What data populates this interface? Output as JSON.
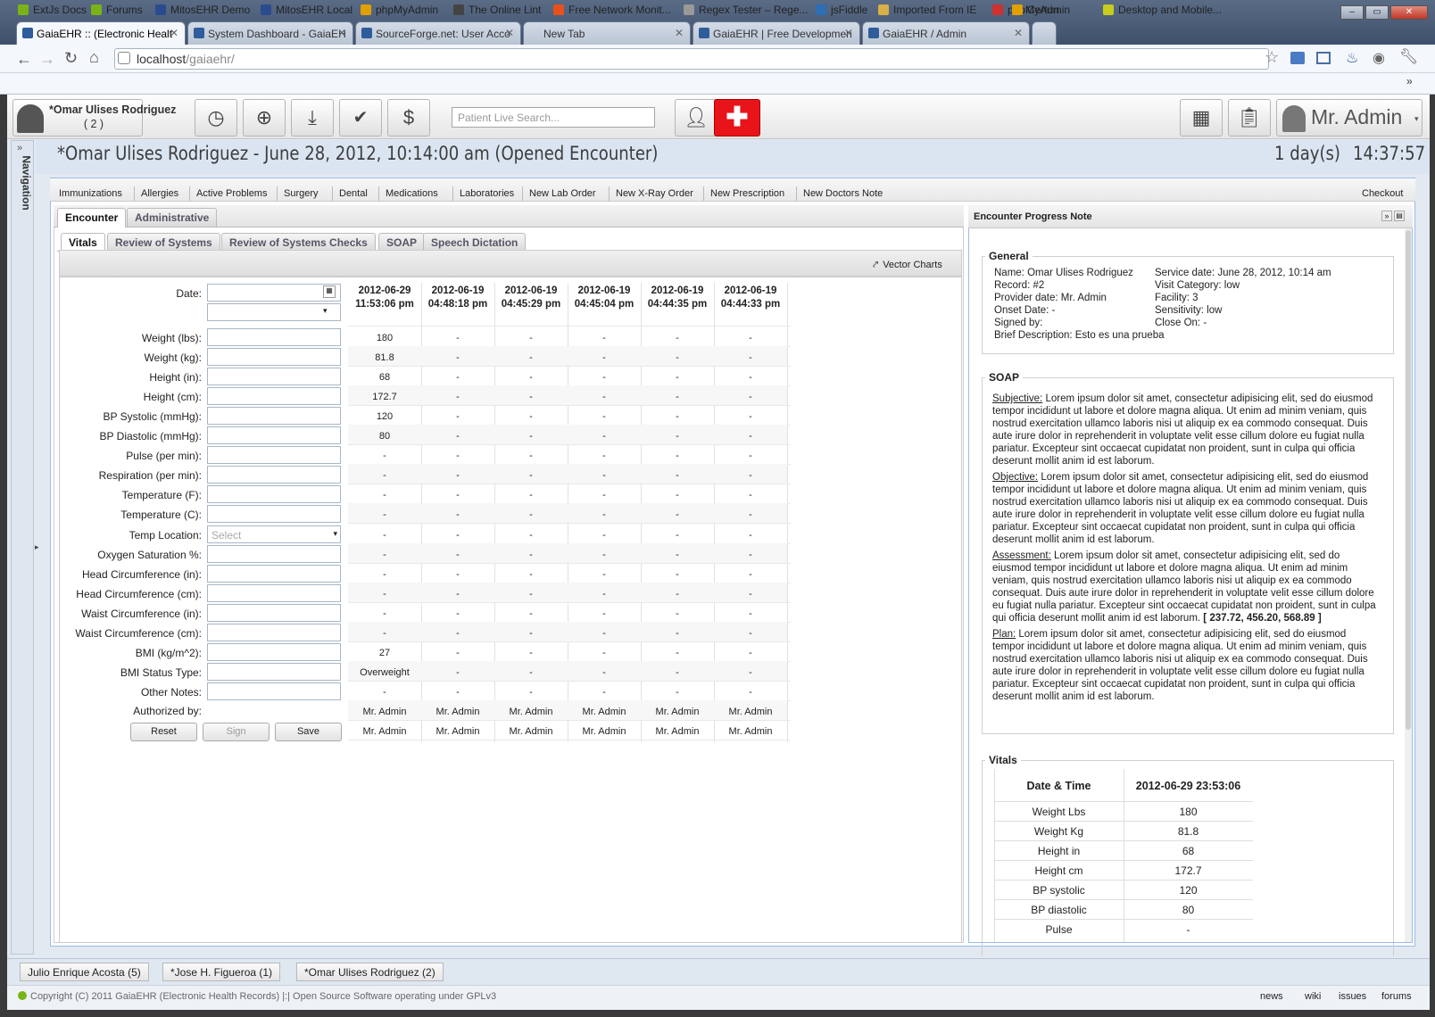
{
  "browser": {
    "tabs": [
      "GaiaEHR :: (Electronic Healt",
      "System Dashboard - GaiaEH",
      "SourceForge.net: User Acco",
      "New Tab",
      "GaiaEHR | Free Developmen",
      "GaiaEHR / Admin"
    ],
    "url_host": "localhost",
    "url_path": "/gaiaehr/",
    "bookmarks": [
      "ExtJs Docs",
      "Forums",
      "MitosEHR Demo",
      "MitosEHR Local",
      "phpMyAdmin",
      "The Online Lint",
      "Free Network Monit...",
      "Regex Tester – Rege...",
      "jsFiddle",
      "Imported From IE",
      "phpMyAdmin",
      "Certun",
      "Desktop and Mobile..."
    ],
    "bookmark_colors": [
      "#7ab317",
      "#7ab317",
      "#2a4c8f",
      "#2a4c8f",
      "#e0a000",
      "#444444",
      "#e8501e",
      "#999999",
      "#2f6db5",
      "#d7b048",
      "#d03030",
      "#e0a000",
      "#c7cc1f",
      "#7ab317"
    ]
  },
  "app": {
    "patient_name": "*Omar Ulises Rodriguez",
    "patient_record": "( 2 )",
    "search_placeholder": "Patient Live Search...",
    "user": "Mr. Admin",
    "navigation_label": "Navigation",
    "encounter_title": "*Omar Ulises Rodriguez - June 28, 2012, 10:14:00 am (Opened Encounter)",
    "elapsed_days": "1 day(s)",
    "elapsed_time": "14:37:57",
    "accent_red": "#e8141a"
  },
  "shortcuts": [
    "Immunizations",
    "Allergies",
    "Active Problems",
    "Surgery",
    "Dental",
    "Medications",
    "Laboratories",
    "New Lab Order",
    "New X-Ray Order",
    "New Prescription",
    "New Doctors Note"
  ],
  "checkout": "Checkout",
  "encounter_tabs": [
    "Encounter",
    "Administrative"
  ],
  "vitals_tabs": [
    "Vitals",
    "Review of Systems",
    "Review of Systems Checks",
    "SOAP",
    "Speech Dictation"
  ],
  "vector_charts": "Vector Charts",
  "form": {
    "date_label": "Date:",
    "labels": [
      "Weight (lbs):",
      "Weight (kg):",
      "Height (in):",
      "Height (cm):",
      "BP Systolic (mmHg):",
      "BP Diastolic (mmHg):",
      "Pulse (per min):",
      "Respiration (per min):",
      "Temperature (F):",
      "Temperature (C):",
      "Temp Location:",
      "Oxygen Saturation %:",
      "Head Circumference (in):",
      "Head Circumference (cm):",
      "Waist Circumference (in):",
      "Waist Circumference (cm):",
      "BMI (kg/m^2):",
      "BMI Status Type:",
      "Other Notes:"
    ],
    "temp_location_placeholder": "Select",
    "authorized_by": "Authorized by:",
    "buttons": [
      "Reset",
      "Sign",
      "Save"
    ]
  },
  "vitals_grid": {
    "headers": [
      [
        "2012-06-29",
        "11:53:06 pm"
      ],
      [
        "2012-06-19",
        "04:48:18 pm"
      ],
      [
        "2012-06-19",
        "04:45:29 pm"
      ],
      [
        "2012-06-19",
        "04:45:04 pm"
      ],
      [
        "2012-06-19",
        "04:44:35 pm"
      ],
      [
        "2012-06-19",
        "04:44:33 pm"
      ]
    ],
    "first_column": [
      "180",
      "81.8",
      "68",
      "172.7",
      "120",
      "80",
      "-",
      "-",
      "-",
      "-",
      "-",
      "-",
      "-",
      "-",
      "-",
      "-",
      "27",
      "Overweight",
      "-"
    ],
    "other_value": "-",
    "authorized": "Mr. Admin"
  },
  "progress_note": {
    "title": "Encounter Progress Note",
    "general_legend": "General",
    "general_left": [
      "Name: Omar Ulises Rodriguez",
      "Record: #2",
      "Provider date: Mr. Admin",
      "Onset Date: -",
      "Signed by:",
      "Brief Description: Esto es una prueba"
    ],
    "general_right": [
      "Service date: June 28, 2012, 10:14 am",
      "Visit Category: low",
      "Facility: 3",
      "Sensitivity: low",
      "Close On: -"
    ],
    "soap_legend": "SOAP",
    "soap": [
      {
        "label": "Subjective:",
        "text": " Lorem ipsum dolor sit amet, consectetur adipisicing elit, sed do eiusmod tempor incididunt ut labore et dolore magna aliqua. Ut enim ad minim veniam, quis nostrud exercitation ullamco laboris nisi ut aliquip ex ea commodo consequat. Duis aute irure dolor in reprehenderit in voluptate velit esse cillum dolore eu fugiat nulla pariatur. Excepteur sint occaecat cupidatat non proident, sunt in culpa qui officia deserunt mollit anim id est laborum."
      },
      {
        "label": "Objective:",
        "text": " Lorem ipsum dolor sit amet, consectetur adipisicing elit, sed do eiusmod tempor incididunt ut labore et dolore magna aliqua. Ut enim ad minim veniam, quis nostrud exercitation ullamco laboris nisi ut aliquip ex ea commodo consequat. Duis aute irure dolor in reprehenderit in voluptate velit esse cillum dolore eu fugiat nulla pariatur. Excepteur sint occaecat cupidatat non proident, sunt in culpa qui officia deserunt mollit anim id est laborum."
      },
      {
        "label": "Assessment:",
        "text": " Lorem ipsum dolor sit amet, consectetur adipisicing elit, sed do eiusmod tempor incididunt ut labore et dolore magna aliqua. Ut enim ad minim veniam, quis nostrud exercitation ullamco laboris nisi ut aliquip ex ea commodo consequat. Duis aute irure dolor in reprehenderit in voluptate velit esse cillum dolore eu fugiat nulla pariatur. Excepteur sint occaecat cupidatat non proident, sunt in culpa qui officia deserunt mollit anim id est laborum.",
        "extra": " [ 237.72, 456.20, 568.89 ]"
      },
      {
        "label": "Plan:",
        "text": " Lorem ipsum dolor sit amet, consectetur adipisicing elit, sed do eiusmod tempor incididunt ut labore et dolore magna aliqua. Ut enim ad minim veniam, quis nostrud exercitation ullamco laboris nisi ut aliquip ex ea commodo consequat. Duis aute irure dolor in reprehenderit in voluptate velit esse cillum dolore eu fugiat nulla pariatur. Excepteur sint occaecat cupidatat non proident, sunt in culpa qui officia deserunt mollit anim id est laborum."
      }
    ],
    "vitals_legend": "Vitals",
    "vitals_header": [
      "Date & Time",
      "2012-06-29 23:53:06"
    ],
    "vitals_rows": [
      [
        "Weight Lbs",
        "180"
      ],
      [
        "Weight Kg",
        "81.8"
      ],
      [
        "Height in",
        "68"
      ],
      [
        "Height cm",
        "172.7"
      ],
      [
        "BP systolic",
        "120"
      ],
      [
        "BP diastolic",
        "80"
      ],
      [
        "Pulse",
        "-"
      ]
    ]
  },
  "open_patients": [
    "Julio Enrique Acosta (5)",
    "*Jose H. Figueroa (1)",
    "*Omar Ulises Rodriguez (2)"
  ],
  "footer": {
    "copyright": "Copyright (C) 2011 GaiaEHR (Electronic Health Records) |:| Open Source Software operating under GPLv3",
    "links": [
      "news",
      "wiki",
      "issues",
      "forums"
    ]
  }
}
